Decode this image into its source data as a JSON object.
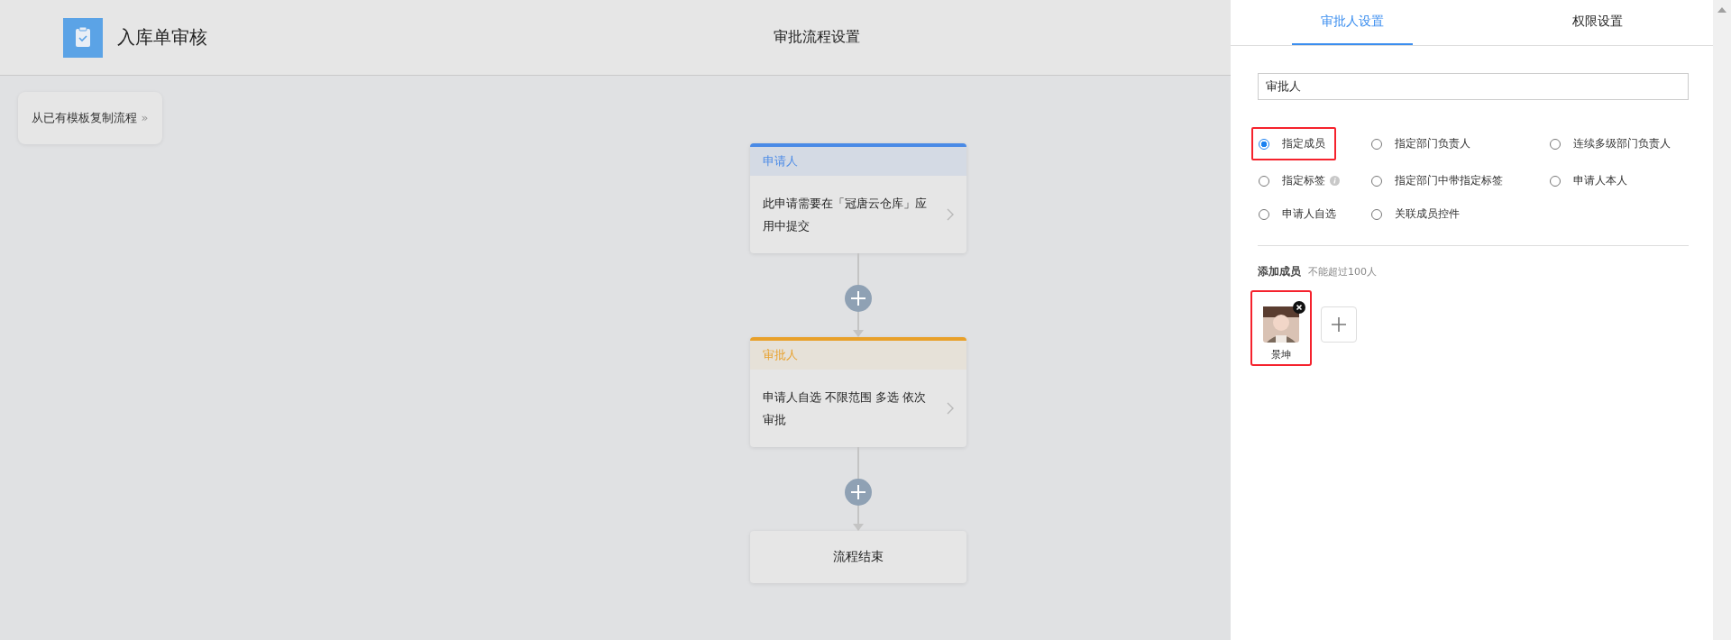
{
  "header": {
    "app_title": "入库单审核",
    "page_title": "审批流程设置"
  },
  "copy_button": {
    "label": "从已有模板复制流程",
    "icon": "»"
  },
  "flow": [
    {
      "kind": "applicant",
      "title": "申请人",
      "text": "此申请需要在「冠唐云仓库」应用中提交",
      "color": "#4a8ae6"
    },
    {
      "kind": "approver",
      "title": "审批人",
      "text": "申请人自选 不限范围 多选 依次审批",
      "color": "#e8a02a"
    },
    {
      "kind": "end",
      "title": "流程结束"
    }
  ],
  "tabs": [
    {
      "label": "审批人设置",
      "selected": true
    },
    {
      "label": "权限设置",
      "selected": false
    }
  ],
  "name_field": {
    "value": "审批人"
  },
  "options": [
    {
      "label": "指定成员",
      "selected": true,
      "highlighted": true,
      "info": false
    },
    {
      "label": "指定部门负责人",
      "selected": false,
      "highlighted": false,
      "info": false
    },
    {
      "label": "连续多级部门负责人",
      "selected": false,
      "highlighted": false,
      "info": false
    },
    {
      "label": "指定标签",
      "selected": false,
      "highlighted": false,
      "info": true
    },
    {
      "label": "指定部门中带指定标签",
      "selected": false,
      "highlighted": false,
      "info": false
    },
    {
      "label": "申请人本人",
      "selected": false,
      "highlighted": false,
      "info": false
    },
    {
      "label": "申请人自选",
      "selected": false,
      "highlighted": false,
      "info": false
    },
    {
      "label": "关联成员控件",
      "selected": false,
      "highlighted": false,
      "info": false
    }
  ],
  "members_section": {
    "title": "添加成员",
    "hint": "不能超过100人"
  },
  "members": [
    {
      "name": "景坤",
      "highlighted": true
    }
  ]
}
